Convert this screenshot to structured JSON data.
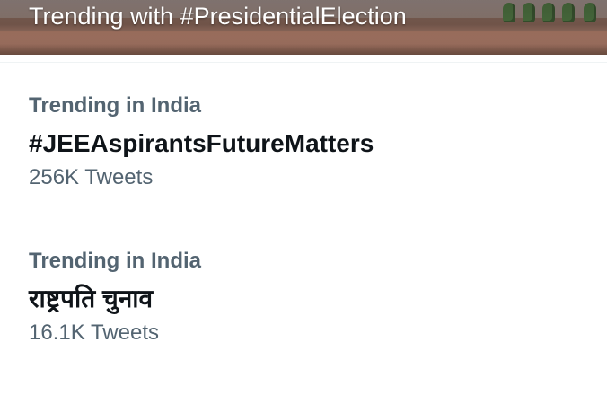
{
  "banner": {
    "title": "Trending with #PresidentialElection"
  },
  "trends": [
    {
      "context": "Trending in India",
      "topic": "#JEEAspirantsFutureMatters",
      "count": "256K Tweets"
    },
    {
      "context": "Trending in India",
      "topic": "राष्ट्रपति चुनाव",
      "count": "16.1K Tweets"
    }
  ],
  "colors": {
    "primary_text": "#0f1419",
    "secondary_text": "#536471",
    "divider": "#eff3f4"
  }
}
